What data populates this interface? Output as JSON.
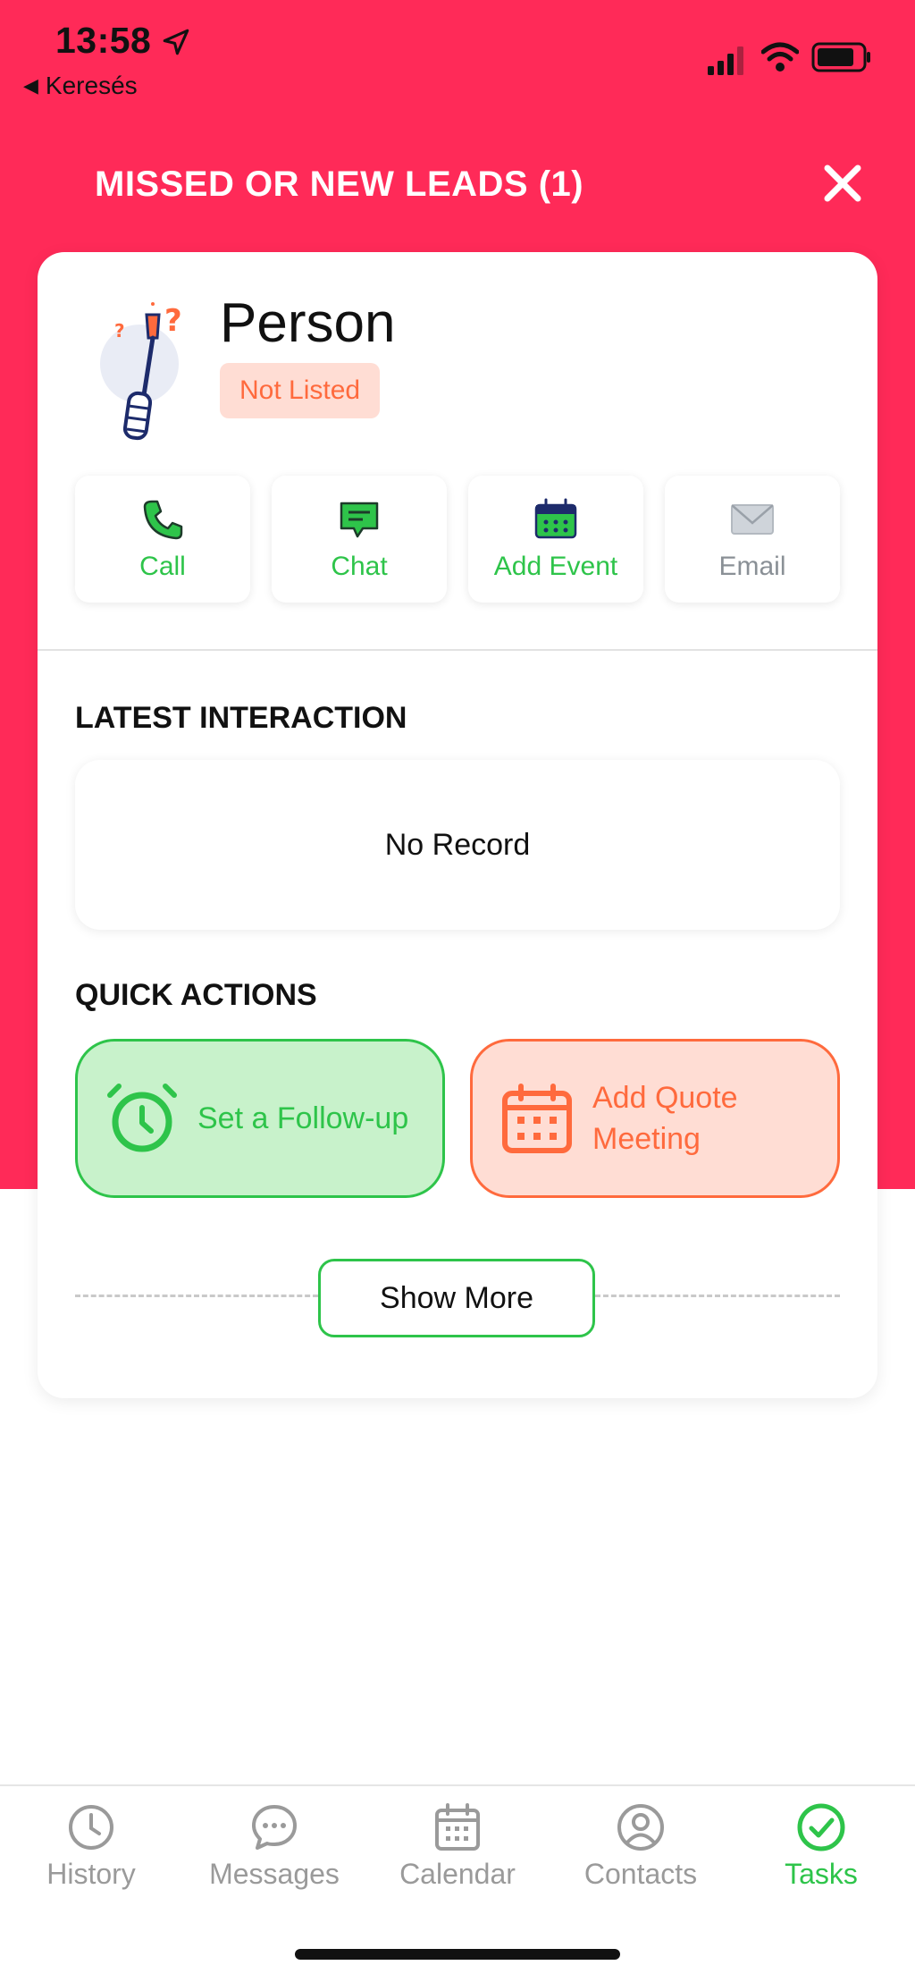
{
  "status_bar": {
    "time": "13:58",
    "back_label": "Keresés",
    "icons": [
      "location-arrow-icon",
      "cellular-signal-icon",
      "wifi-icon",
      "battery-icon"
    ]
  },
  "header": {
    "title": "MISSED OR NEW LEADS (1)",
    "close_icon": "close-icon"
  },
  "lead": {
    "name": "Person",
    "status": "Not Listed",
    "avatar_icon": "screwdriver-question-icon"
  },
  "actions": [
    {
      "label": "Call",
      "icon": "phone-icon",
      "enabled": true
    },
    {
      "label": "Chat",
      "icon": "chat-bubble-icon",
      "enabled": true
    },
    {
      "label": "Add Event",
      "icon": "calendar-icon",
      "enabled": true
    },
    {
      "label": "Email",
      "icon": "envelope-icon",
      "enabled": false
    }
  ],
  "latest_interaction": {
    "heading": "LATEST INTERACTION",
    "empty_text": "No Record"
  },
  "quick_actions": {
    "heading": "QUICK ACTIONS",
    "items": [
      {
        "label": "Set a Follow-up",
        "icon": "alarm-clock-icon"
      },
      {
        "label": "Add Quote Meeting",
        "icon": "calendar-grid-icon"
      }
    ]
  },
  "show_more_label": "Show More",
  "tabs": [
    {
      "label": "History",
      "icon": "clock-icon",
      "active": false
    },
    {
      "label": "Messages",
      "icon": "message-bubble-icon",
      "active": false
    },
    {
      "label": "Calendar",
      "icon": "calendar-icon",
      "active": false
    },
    {
      "label": "Contacts",
      "icon": "user-circle-icon",
      "active": false
    },
    {
      "label": "Tasks",
      "icon": "check-circle-icon",
      "active": true
    }
  ],
  "colors": {
    "header_bg": "#ff2a58",
    "accent_green": "#2ec44a",
    "accent_orange": "#ff6a3d",
    "inactive_gray": "#9a9a9a"
  }
}
